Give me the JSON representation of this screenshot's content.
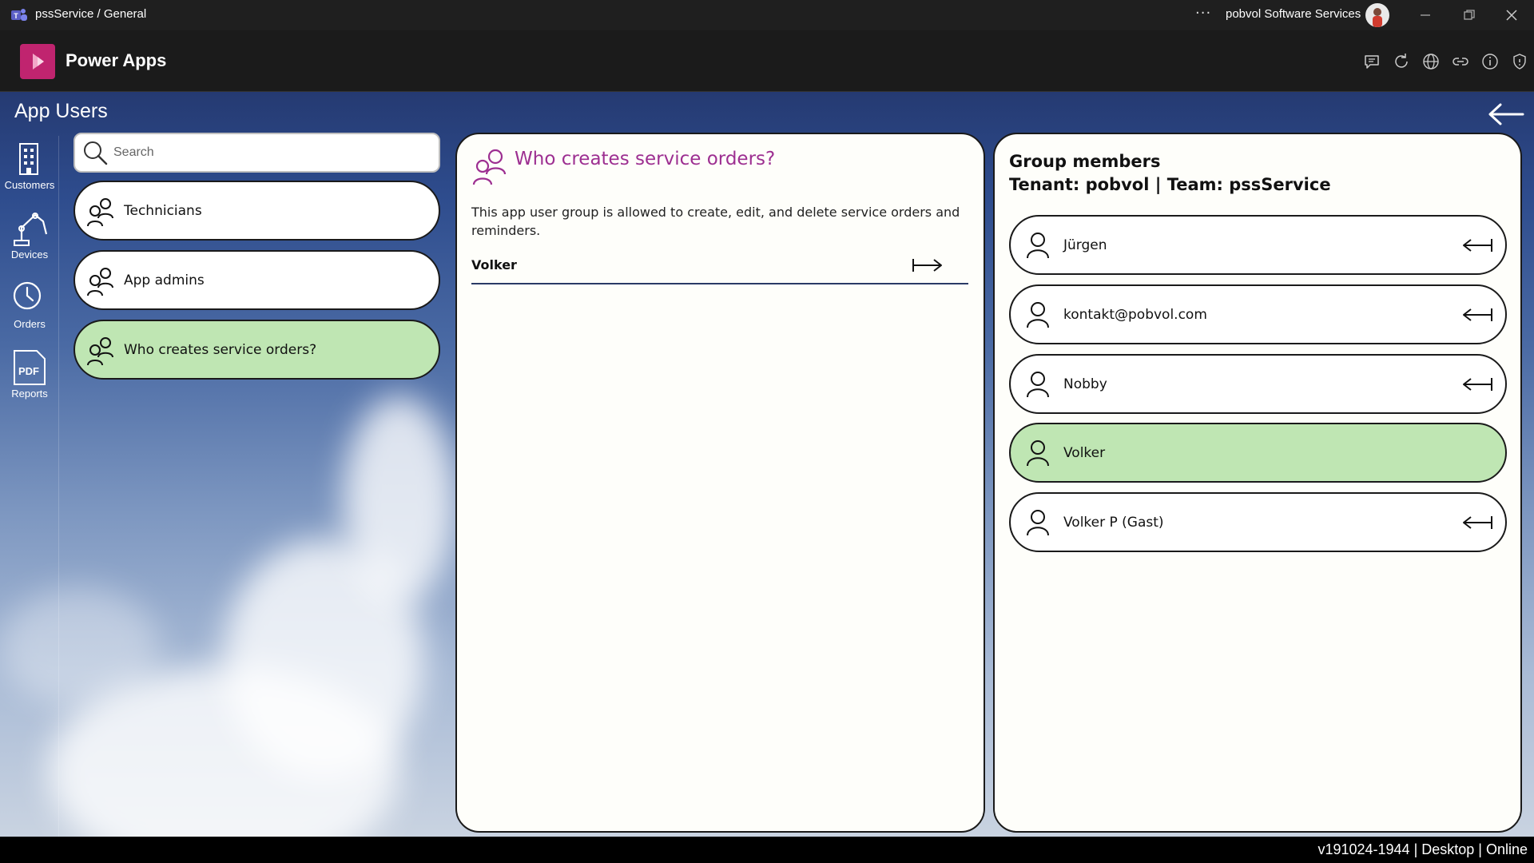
{
  "window": {
    "title": "pssService / General",
    "organization": "pobvol Software Services",
    "more_label": "···"
  },
  "app": {
    "name": "Power Apps"
  },
  "page": {
    "title": "App Users"
  },
  "nav": {
    "items": [
      {
        "label": "Customers",
        "icon": "building-icon"
      },
      {
        "label": "Devices",
        "icon": "robot-arm-icon"
      },
      {
        "label": "Orders",
        "icon": "clock-icon"
      },
      {
        "label": "Reports",
        "icon": "pdf-icon"
      }
    ]
  },
  "search": {
    "placeholder": "Search",
    "value": ""
  },
  "groups": [
    {
      "label": "Technicians",
      "selected": false
    },
    {
      "label": "App admins",
      "selected": false
    },
    {
      "label": "Who creates service orders?",
      "selected": true
    }
  ],
  "detail": {
    "title": "Who creates service orders?",
    "description": "This app user group is allowed to create, edit, and delete service orders and reminders.",
    "candidates": [
      {
        "name": "Volker"
      }
    ]
  },
  "members": {
    "heading": "Group members",
    "subheading": "Tenant: pobvol | Team: pssService",
    "items": [
      {
        "name": "Jürgen",
        "selected": false
      },
      {
        "name": "kontakt@pobvol.com",
        "selected": false
      },
      {
        "name": "Nobby",
        "selected": false
      },
      {
        "name": "Volker",
        "selected": true
      },
      {
        "name": "Volker P (Gast)",
        "selected": false
      }
    ]
  },
  "status": {
    "text": "v191024-1944 | Desktop | Online"
  },
  "colors": {
    "accent_purple": "#9d2f91",
    "selected_green": "#bfe6b3",
    "powerapps_pink": "#c0246f"
  }
}
